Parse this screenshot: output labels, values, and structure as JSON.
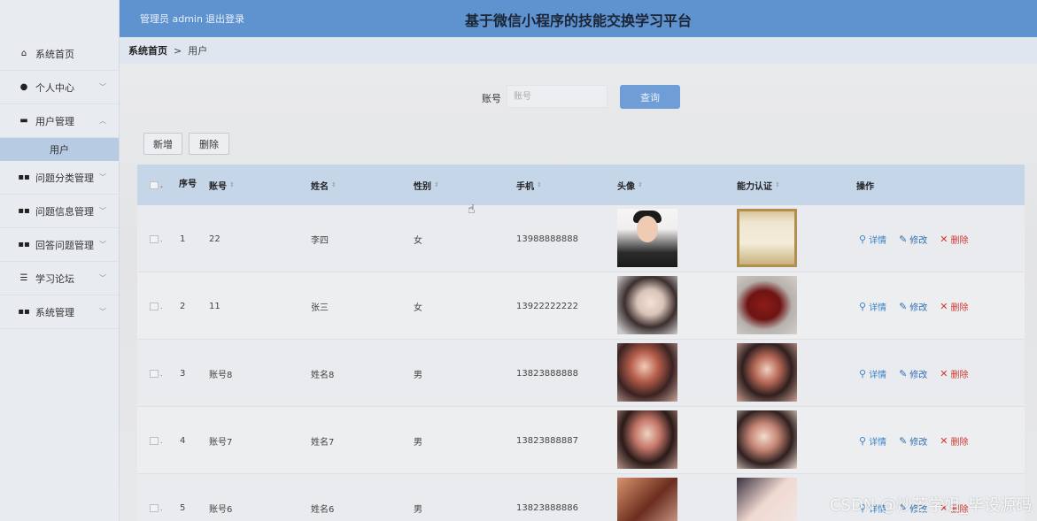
{
  "header": {
    "admin_text": "管理员 admin",
    "logout_label": "退出登录",
    "title": "基于微信小程序的技能交换学习平台"
  },
  "sidebar": {
    "items": [
      {
        "label": "系统首页",
        "icon": "home-icon",
        "glyph": "⌂",
        "chevron": ""
      },
      {
        "label": "个人中心",
        "icon": "user-icon",
        "glyph": "●",
        "chevron": "﹀"
      },
      {
        "label": "用户管理",
        "icon": "chat-icon",
        "glyph": "▬",
        "chevron": "︿"
      },
      {
        "label": "问题分类管理",
        "icon": "grid-icon",
        "glyph": "▪▪",
        "chevron": "﹀"
      },
      {
        "label": "问题信息管理",
        "icon": "grid-icon",
        "glyph": "▪▪",
        "chevron": "﹀"
      },
      {
        "label": "回答问题管理",
        "icon": "grid-icon",
        "glyph": "▪▪",
        "chevron": "﹀"
      },
      {
        "label": "学习论坛",
        "icon": "sliders-icon",
        "glyph": "☰",
        "chevron": "﹀"
      },
      {
        "label": "系统管理",
        "icon": "grid-icon",
        "glyph": "▪▪",
        "chevron": "﹀"
      }
    ],
    "submenu": {
      "label": "用户"
    }
  },
  "breadcrumb": {
    "home": "系统首页",
    "separator": ">",
    "current": "用户"
  },
  "search": {
    "label": "账号",
    "placeholder": "账号",
    "button_label": "查询"
  },
  "toolbar": {
    "add_label": "新增",
    "delete_label": "删除"
  },
  "table": {
    "columns": {
      "index": "序号",
      "account": "账号",
      "name": "姓名",
      "gender": "性别",
      "phone": "手机",
      "avatar": "头像",
      "certificate": "能力认证",
      "actions": "操作"
    },
    "rows": [
      {
        "index": "1",
        "account": "22",
        "name": "李四",
        "gender": "女",
        "phone": "13988888888"
      },
      {
        "index": "2",
        "account": "11",
        "name": "张三",
        "gender": "女",
        "phone": "13922222222"
      },
      {
        "index": "3",
        "account": "账号8",
        "name": "姓名8",
        "gender": "男",
        "phone": "13823888888"
      },
      {
        "index": "4",
        "account": "账号7",
        "name": "姓名7",
        "gender": "男",
        "phone": "13823888887"
      },
      {
        "index": "5",
        "account": "账号6",
        "name": "姓名6",
        "gender": "男",
        "phone": "13823888886"
      }
    ],
    "row_actions": {
      "detail": "详情",
      "edit": "修改",
      "delete": "删除"
    }
  },
  "watermark": "CSDN @炒芝学姐_毕设源码",
  "colors": {
    "header_bg": "#5f93cf",
    "sidebar_bg": "#e8ebef",
    "table_header_bg": "#c5d6e9",
    "search_button": "#6f9ed6",
    "detail_action": "#3b82c9",
    "delete_action": "#d0362f"
  }
}
